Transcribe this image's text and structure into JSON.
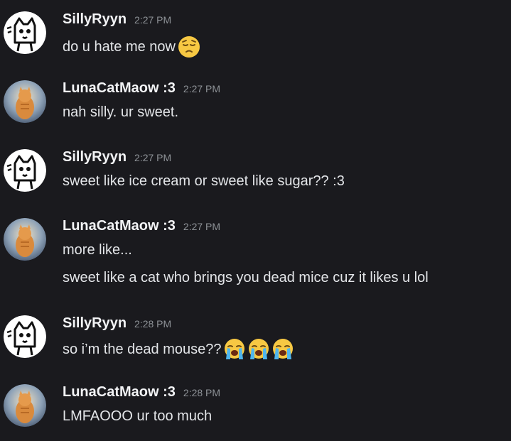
{
  "messages": [
    {
      "author": "SillyRyyn",
      "time": "2:27 PM",
      "lines": [
        "do u hate me now"
      ],
      "emojis": [
        "pensive-face"
      ]
    },
    {
      "author": "LunaCatMaow :3",
      "time": "2:27 PM",
      "lines": [
        "nah silly. ur sweet."
      ]
    },
    {
      "author": "SillyRyyn",
      "time": "2:27 PM",
      "lines": [
        "sweet like ice cream or sweet like sugar?? :3"
      ]
    },
    {
      "author": "LunaCatMaow :3",
      "time": "2:27 PM",
      "lines": [
        "more like...",
        "sweet like a cat who brings you dead mice cuz it likes u lol"
      ]
    },
    {
      "author": "SillyRyyn",
      "time": "2:28 PM",
      "lines": [
        "so i’m the dead mouse??"
      ],
      "emojis": [
        "loudly-crying-face",
        "loudly-crying-face",
        "loudly-crying-face"
      ]
    },
    {
      "author": "LunaCatMaow :3",
      "time": "2:28 PM",
      "lines": [
        "LMFAOOO ur too much"
      ]
    }
  ],
  "colors": {
    "background": "#1a1a1e",
    "username": "#f2f3f5",
    "timestamp": "#8e9297",
    "message_text": "#e3e5e8"
  },
  "icons": {
    "silly_avatar": "cartoon-cat-avatar",
    "luna_avatar": "orange-cat-photo-avatar"
  }
}
